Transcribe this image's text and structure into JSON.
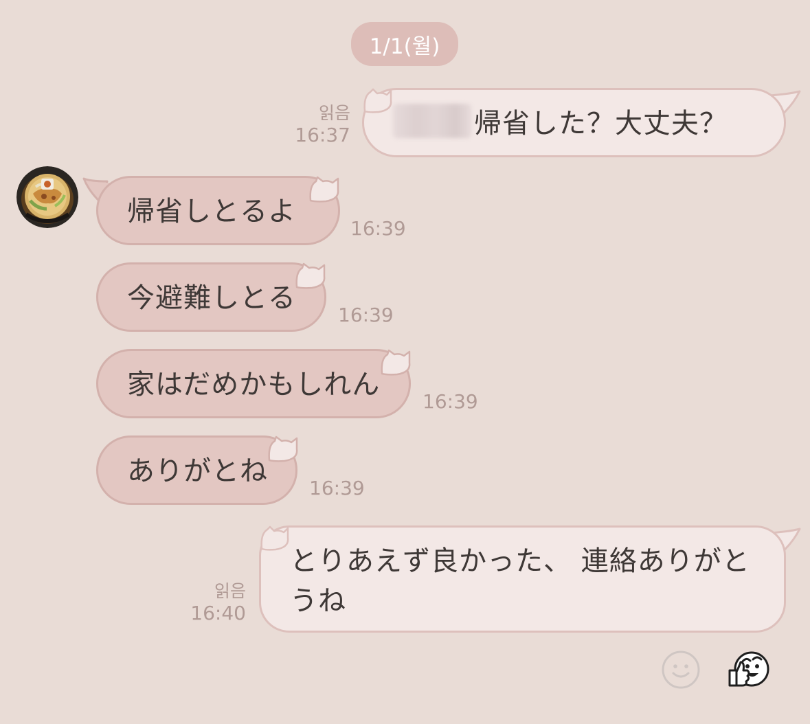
{
  "date_divider": "1/1(월)",
  "messages": [
    {
      "side": "me",
      "text": "帰省した？大丈夫？",
      "read": "읽음",
      "time": "16:37"
    },
    {
      "side": "them",
      "text": "帰省しとるよ",
      "time": "16:39"
    },
    {
      "side": "them",
      "text": "今避難しとる",
      "time": "16:39"
    },
    {
      "side": "them",
      "text": "家はだめかもしれん",
      "time": "16:39"
    },
    {
      "side": "them",
      "text": "ありがとね",
      "time": "16:39"
    },
    {
      "side": "me",
      "text_line1": "とりあえず良かった、 連絡ありがと",
      "text_line2": "うね",
      "read": "읽음",
      "time": "16:40"
    }
  ],
  "icons": {
    "avatar": "ramen-bowl-avatar",
    "emoji_button": "smiley-icon",
    "sticker_button": "thumbs-up-sticker-icon"
  },
  "colors": {
    "background": "#E9DCD6",
    "sent_bubble": "#F3E8E6",
    "received_bubble": "#E3C7C2",
    "date_pill": "#DDBDB8"
  }
}
